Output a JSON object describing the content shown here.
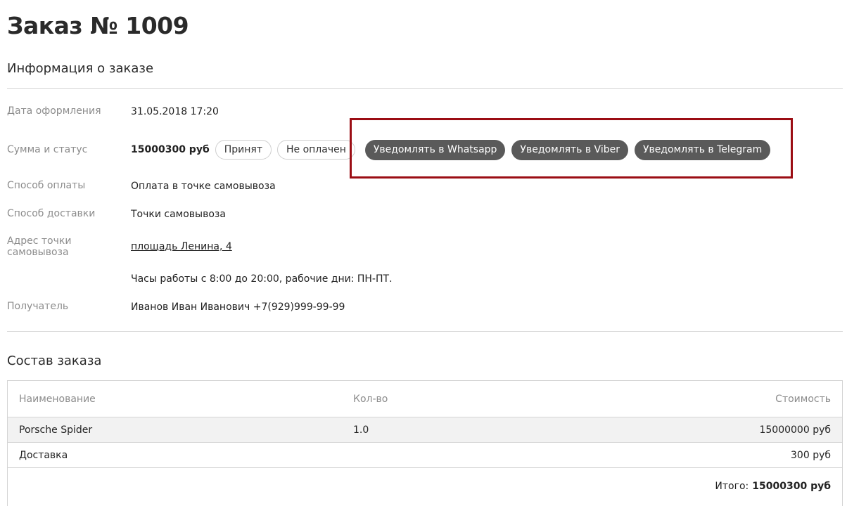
{
  "order": {
    "title": "Заказ № 1009"
  },
  "info": {
    "section_title": "Информация о заказе",
    "date_label": "Дата оформления",
    "date_value": "31.05.2018 17:20",
    "status_label": "Сумма и статус",
    "amount": "15000300 руб",
    "status_accepted": "Принят",
    "status_payment": "Не оплачен",
    "notify_whatsapp": "Уведомлять в Whatsapp",
    "notify_viber": "Уведомлять в Viber",
    "notify_telegram": "Уведомлять в Telegram",
    "payment_label": "Способ оплаты",
    "payment_value": "Оплата в точке самовывоза",
    "delivery_label": "Способ доставки",
    "delivery_value": "Точки самовывоза",
    "address_label": "Адрес точки самовывоза",
    "address_value": "площадь Ленина, 4",
    "hours_value": "Часы работы с 8:00 до 20:00, рабочие дни: ПН-ПТ.",
    "recipient_label": "Получатель",
    "recipient_value": "Иванов Иван Иванович +7(929)999-99-99"
  },
  "items": {
    "section_title": "Состав заказа",
    "columns": [
      "Наименование",
      "Кол-во",
      "Стоимость"
    ],
    "rows": [
      {
        "name": "Porsche Spider",
        "qty": "1.0",
        "cost": "15000000 руб"
      },
      {
        "name": "Доставка",
        "qty": "",
        "cost": "300 руб"
      }
    ],
    "total_label": "Итого:",
    "total_value": "15000300 руб"
  },
  "colors": {
    "highlight": "#9b0d14",
    "notify_button": "#5a5a5a"
  }
}
